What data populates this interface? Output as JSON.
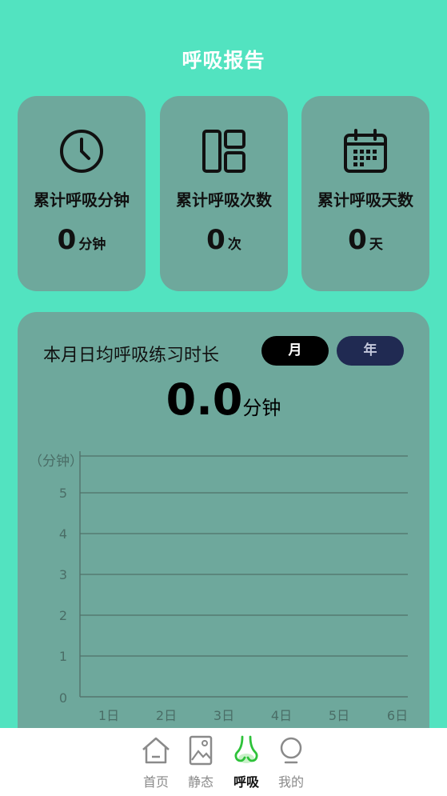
{
  "page": {
    "title": "呼吸报告"
  },
  "stats": [
    {
      "icon": "clock-icon",
      "label": "累计呼吸分钟",
      "value": "0",
      "unit": "分钟"
    },
    {
      "icon": "layout-icon",
      "label": "累计呼吸次数",
      "value": "0",
      "unit": "次"
    },
    {
      "icon": "calendar-icon",
      "label": "累计呼吸天数",
      "value": "0",
      "unit": "天"
    }
  ],
  "chart_section": {
    "title": "本月日均呼吸练习时长",
    "toggle_month": "月",
    "toggle_year": "年",
    "selected": "月",
    "average_value": "0.0",
    "average_unit": "分钟"
  },
  "chart_data": {
    "type": "line",
    "ylabel": "（分钟）",
    "categories": [
      "1日",
      "2日",
      "3日",
      "4日",
      "5日",
      "6日"
    ],
    "yticks": [
      "0",
      "1",
      "2",
      "3",
      "4",
      "5"
    ],
    "ylim": [
      0,
      6
    ],
    "series": [
      {
        "values": []
      }
    ],
    "grid": true
  },
  "nav": [
    {
      "icon": "home-icon",
      "label": "首页",
      "active": false
    },
    {
      "icon": "picture-icon",
      "label": "静态",
      "active": false
    },
    {
      "icon": "nose-icon",
      "label": "呼吸",
      "active": true
    },
    {
      "icon": "bulb-icon",
      "label": "我的",
      "active": false
    }
  ],
  "colors": {
    "background": "#52e3c0",
    "card": "#6ea89c",
    "toggle_active": "#000000",
    "toggle_inactive": "#202a52",
    "nav_active": "#2ec23a"
  }
}
